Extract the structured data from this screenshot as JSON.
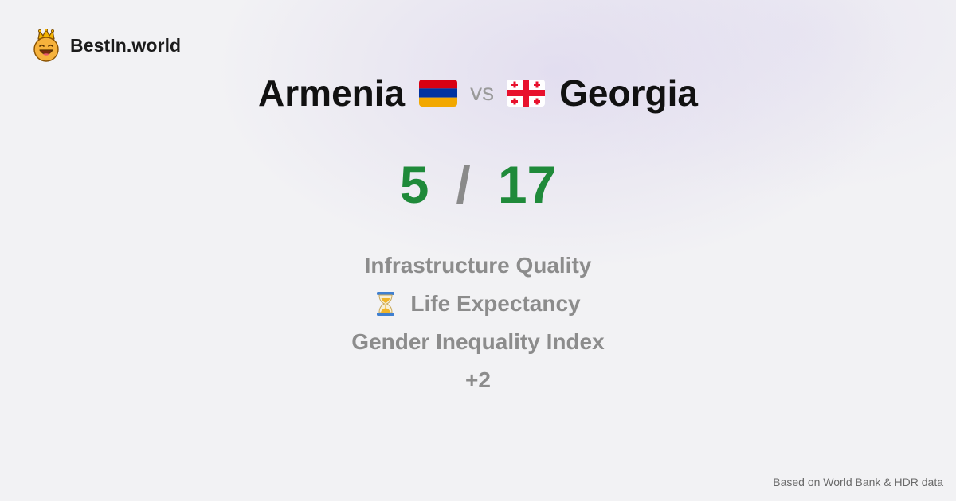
{
  "brand": {
    "name": "BestIn.world",
    "icon": "crown-smiley-logo"
  },
  "comparison": {
    "left": {
      "name": "Armenia",
      "flag": "armenia-flag",
      "score": "5"
    },
    "vs": "vs",
    "right": {
      "name": "Georgia",
      "flag": "georgia-flag",
      "score": "17"
    },
    "separator": "/"
  },
  "metrics": [
    {
      "label": "Infrastructure Quality",
      "icon": null
    },
    {
      "label": "Life Expectancy",
      "icon": "hourglass-icon"
    },
    {
      "label": "Gender Inequality Index",
      "icon": null
    }
  ],
  "more_count": "+2",
  "footer": {
    "source": "Based on World Bank & HDR data"
  },
  "colors": {
    "score_green": "#1f8a3a",
    "muted_text": "#8c8c8c",
    "title_text": "#111111"
  }
}
